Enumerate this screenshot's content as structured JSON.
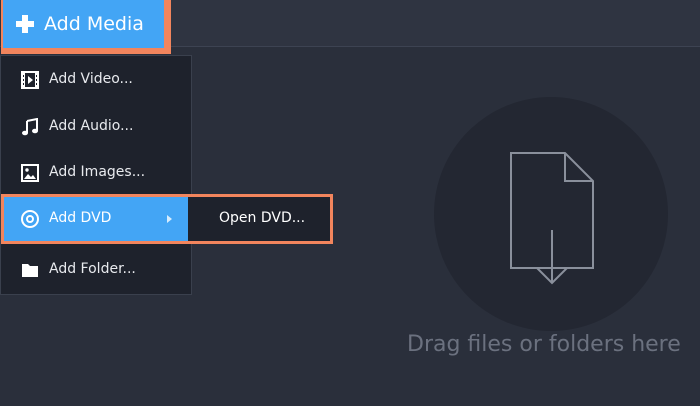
{
  "toolbar": {
    "add_media_label": "Add Media",
    "add_media_icon": "plus-icon"
  },
  "menu": {
    "items": [
      {
        "label": "Add Video...",
        "icon": "film-icon"
      },
      {
        "label": "Add Audio...",
        "icon": "music-note-icon"
      },
      {
        "label": "Add Images...",
        "icon": "image-icon"
      },
      {
        "label": "Add DVD",
        "icon": "disc-icon"
      },
      {
        "label": "Add Folder...",
        "icon": "folder-icon"
      }
    ],
    "submenu": {
      "label": "Open DVD..."
    }
  },
  "dropzone": {
    "text": "Drag files or folders here",
    "icon": "file-download-icon"
  },
  "colors": {
    "accent_blue": "#43a5f5",
    "highlight_orange": "#f2855d",
    "background": "#2a2f3b",
    "menu_background": "#1e222c",
    "dropzone_text": "#6b717f"
  }
}
